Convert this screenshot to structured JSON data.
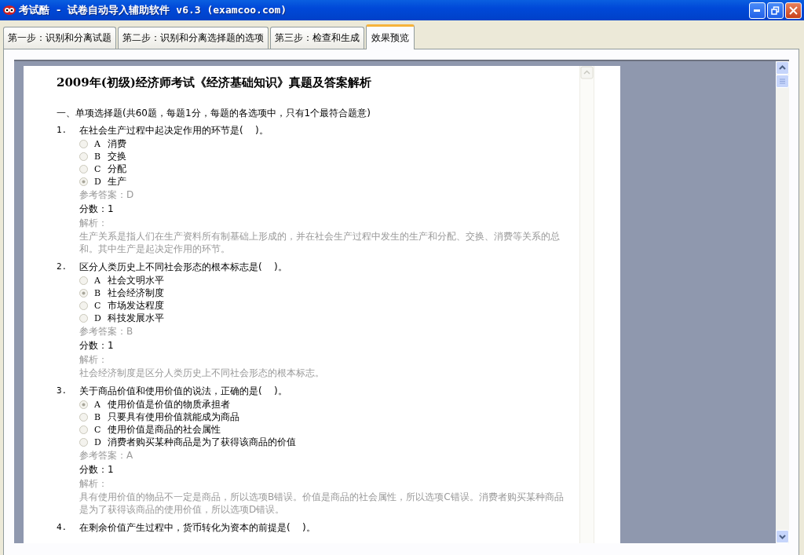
{
  "window": {
    "title": "考试酷 - 试卷自动导入辅助软件 v6.3 (examcoo.com)"
  },
  "tabs": [
    {
      "label": "第一步：识别和分离试题",
      "selected": false
    },
    {
      "label": "第二步：识别和分离选择题的选项",
      "selected": false
    },
    {
      "label": "第三步：检查和生成",
      "selected": false
    },
    {
      "label": "效果预览",
      "selected": true
    }
  ],
  "document": {
    "title": "2009年(初级)经济师考试《经济基础知识》真题及答案解析",
    "section": "一、单项选择题(共60题，每题1分，每题的各选项中，只有1个最符合题意)",
    "questions": [
      {
        "number": "1.",
        "text": "在社会生产过程中起决定作用的环节是(    )。",
        "options": [
          {
            "letter": "A",
            "text": "消费",
            "selected": false
          },
          {
            "letter": "B",
            "text": "交换",
            "selected": false
          },
          {
            "letter": "C",
            "text": "分配",
            "selected": false
          },
          {
            "letter": "D",
            "text": "生产",
            "selected": true
          }
        ],
        "answer": "参考答案：D",
        "score": "分数：1",
        "analysis_label": "解析：",
        "analysis": "生产关系是指人们在生产资料所有制基础上形成的，并在社会生产过程中发生的生产和分配、交换、消费等关系的总和。其中生产是起决定作用的环节。"
      },
      {
        "number": "2.",
        "text": "区分人类历史上不同社会形态的根本标志是(    )。",
        "options": [
          {
            "letter": "A",
            "text": "社会文明水平",
            "selected": false
          },
          {
            "letter": "B",
            "text": "社会经济制度",
            "selected": true
          },
          {
            "letter": "C",
            "text": "市场发达程度",
            "selected": false
          },
          {
            "letter": "D",
            "text": "科技发展水平",
            "selected": false
          }
        ],
        "answer": "参考答案：B",
        "score": "分数：1",
        "analysis_label": "解析：",
        "analysis": "社会经济制度是区分人类历史上不同社会形态的根本标志。"
      },
      {
        "number": "3.",
        "text": "关于商品价值和使用价值的说法，正确的是(    )。",
        "options": [
          {
            "letter": "A",
            "text": "使用价值是价值的物质承担者",
            "selected": true
          },
          {
            "letter": "B",
            "text": "只要具有使用价值就能成为商品",
            "selected": false
          },
          {
            "letter": "C",
            "text": "使用价值是商品的社会属性",
            "selected": false
          },
          {
            "letter": "D",
            "text": "消费者购买某种商品是为了获得该商品的价值",
            "selected": false
          }
        ],
        "answer": "参考答案：A",
        "score": "分数：1",
        "analysis_label": "解析：",
        "analysis": "具有使用价值的物品不一定是商品，所以选项B错误。价值是商品的社会属性，所以选项C错误。消费者购买某种商品是为了获得该商品的使用价值，所以选项D错误。"
      },
      {
        "number": "4.",
        "text": "在剩余价值产生过程中，货币转化为资本的前提是(    )。"
      }
    ]
  }
}
